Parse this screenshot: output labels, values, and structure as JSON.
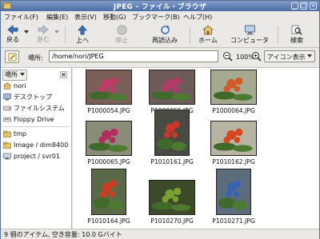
{
  "window": {
    "title": "JPEG - ファイル・ブラウザ"
  },
  "menu": [
    "ファイル(F)",
    "編集(E)",
    "表示(V)",
    "移動(G)",
    "ブックマーク(B)",
    "ヘルプ(H)"
  ],
  "toolbar": {
    "back": "戻る",
    "forward": "進む",
    "up": "上へ",
    "stop": "停止",
    "reload": "再読込み",
    "home": "ホーム",
    "computer": "コンピュータ",
    "search": "検索"
  },
  "location": {
    "label": "場所:",
    "path": "/home/nori/JPEG",
    "zoom": "100%",
    "view": "アイコン表示"
  },
  "sidebar": {
    "header": "場所",
    "items": [
      "nori",
      "デスクトップ",
      "ファイルシステム",
      "Floppy Drive"
    ],
    "bookmarks": [
      "tmp",
      "Image / dim8400",
      "project / svr01"
    ]
  },
  "files": [
    {
      "name": "P1000054.JPG",
      "bg": "#7a5e58",
      "flower": "#c23a6a"
    },
    {
      "name": "P1000055.JPG",
      "bg": "#6c5b58",
      "flower": "#b8386a"
    },
    {
      "name": "P1000064.JPG",
      "bg": "#a4a98f",
      "flower": "#d25a2a"
    },
    {
      "name": "P1000065.JPG",
      "bg": "#8c8a78",
      "flower": "#b22c5c"
    },
    {
      "name": "P1010161.JPG",
      "bg": "#4a4a44",
      "flower": "#c8382a"
    },
    {
      "name": "P1010162.JPG",
      "bg": "#b8b4a4",
      "flower": "#d6471f"
    },
    {
      "name": "P1010164.JPG",
      "bg": "#5a6a48",
      "flower": "#cf3b1e"
    },
    {
      "name": "P1010270.JPG",
      "bg": "#3c4a2a",
      "flower": "#7aa030"
    },
    {
      "name": "P1010271.JPG",
      "bg": "#5d6c7a",
      "flower": "#3a62b0"
    }
  ],
  "status": "9 個のアイテム, 空き容量: 10.0 Gバイト",
  "colors": {
    "titlebar": "#5d7db6",
    "accent": "#3a62b0"
  }
}
